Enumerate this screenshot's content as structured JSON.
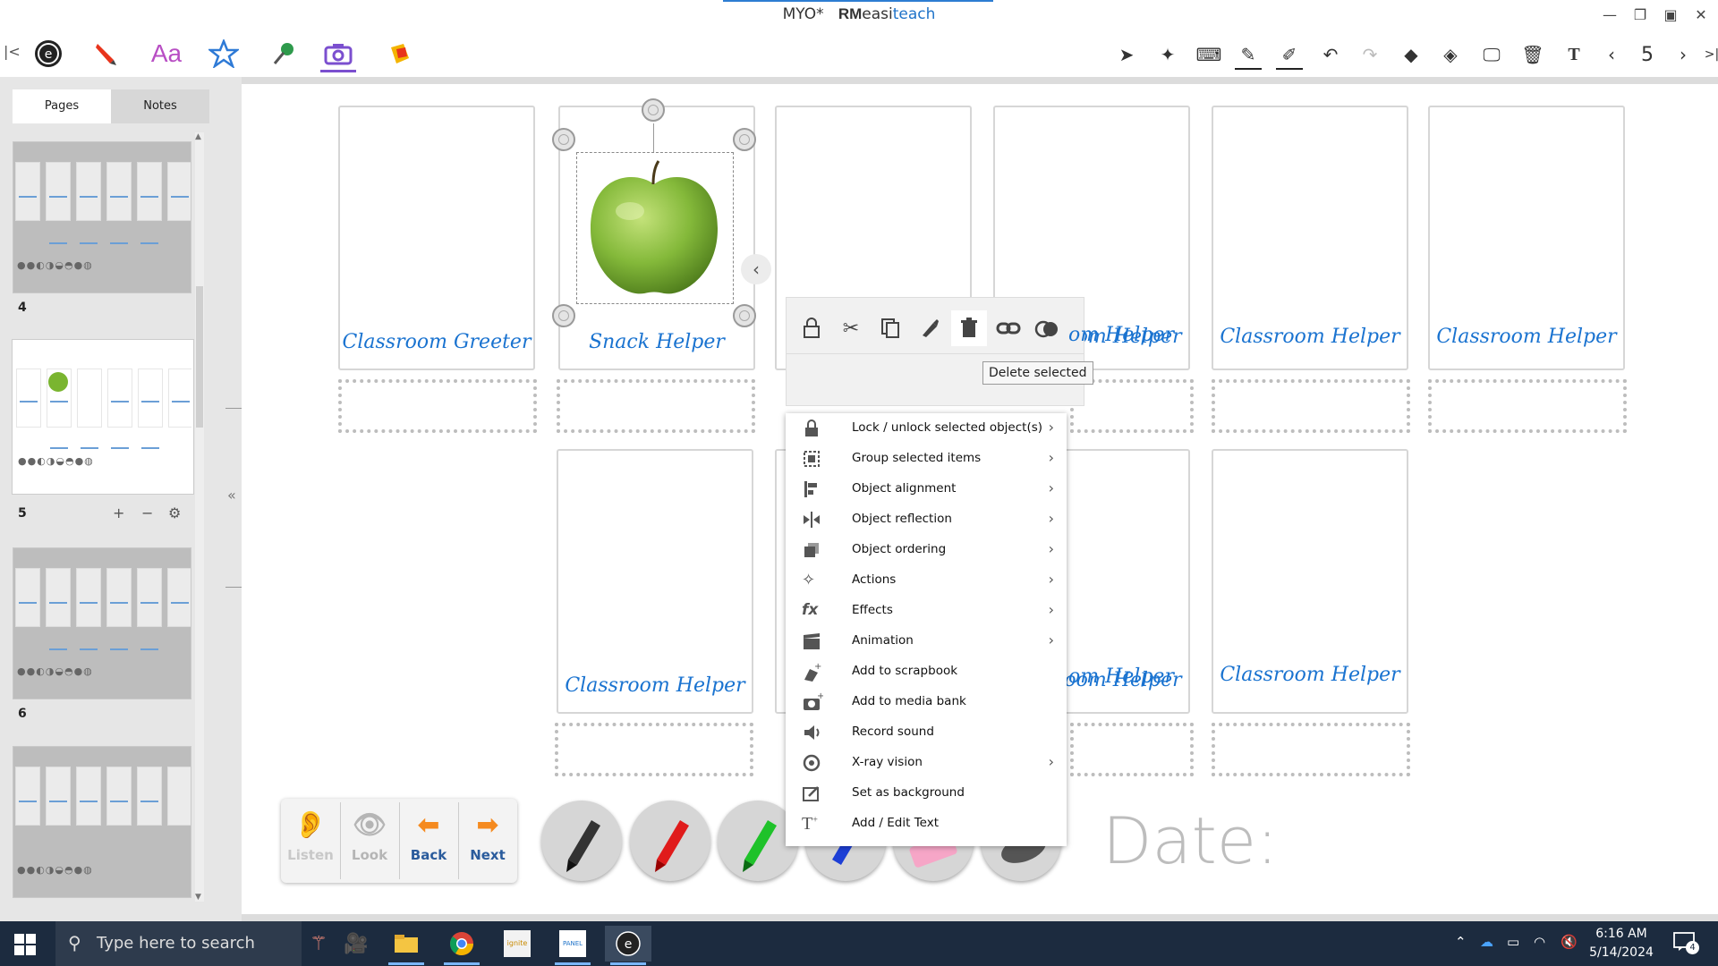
{
  "window": {
    "title_prefix": "MYO*",
    "brand_a": "RM",
    "brand_b": "easi",
    "brand_c": "teach"
  },
  "toolbar": {
    "page_number": "5"
  },
  "left_panel": {
    "tabs": [
      "Pages",
      "Notes"
    ],
    "pages": [
      {
        "number": "4",
        "selected": false
      },
      {
        "number": "5",
        "selected": true
      },
      {
        "number": "6",
        "selected": false
      }
    ],
    "page_controls": {
      "add": "+",
      "remove": "−",
      "settings": "⚙"
    }
  },
  "canvas": {
    "cards_row1": [
      "Classroom Greeter",
      "Snack Helper",
      "",
      "Classroom Helper",
      "Classroom Helper",
      "Classroom Helper"
    ],
    "cards_row2": [
      "Classroom Helper",
      "",
      "Classroom Helper",
      "Classroom Helper"
    ],
    "partial_label_fragment": "om Helper",
    "date_label": "Date:"
  },
  "nav_widget": {
    "listen": "Listen",
    "look": "Look",
    "back": "Back",
    "next": "Next"
  },
  "pens": [
    "black-marker",
    "red-marker",
    "green-marker",
    "blue-marker",
    "eraser",
    "gray-marker"
  ],
  "float_toolbar": {
    "icons": [
      "lock-icon",
      "cut-icon",
      "copy-icon",
      "paste-icon",
      "delete-icon",
      "link-icon",
      "toggle-icon"
    ],
    "tooltip": "Delete selected"
  },
  "context_menu": {
    "items": [
      {
        "label": "Lock / unlock selected object(s)",
        "icon": "lock-icon",
        "submenu": true
      },
      {
        "label": "Group selected items",
        "icon": "group-icon",
        "submenu": true
      },
      {
        "label": "Object alignment",
        "icon": "alignment-icon",
        "submenu": true
      },
      {
        "label": "Object reflection",
        "icon": "reflection-icon",
        "submenu": true
      },
      {
        "label": "Object ordering",
        "icon": "ordering-icon",
        "submenu": true
      },
      {
        "label": "Actions",
        "icon": "actions-icon",
        "submenu": true
      },
      {
        "label": "Effects",
        "icon": "effects-icon",
        "submenu": true
      },
      {
        "label": "Animation",
        "icon": "animation-icon",
        "submenu": true
      },
      {
        "label": "Add to scrapbook",
        "icon": "scrapbook-icon",
        "submenu": false
      },
      {
        "label": "Add to media bank",
        "icon": "camera-icon",
        "submenu": false
      },
      {
        "label": "Record sound",
        "icon": "speaker-icon",
        "submenu": false
      },
      {
        "label": "X-ray vision",
        "icon": "xray-icon",
        "submenu": true
      },
      {
        "label": "Set as background",
        "icon": "background-icon",
        "submenu": false
      },
      {
        "label": "Add / Edit Text",
        "icon": "text-icon",
        "submenu": false
      }
    ]
  },
  "taskbar": {
    "search_placeholder": "Type here to search",
    "time": "6:16 AM",
    "date": "5/14/2024",
    "notification_count": "4"
  },
  "colors": {
    "accent": "#1a73d0",
    "active_tab": "#7b4fcf",
    "taskbar": "#1c2b3f"
  }
}
